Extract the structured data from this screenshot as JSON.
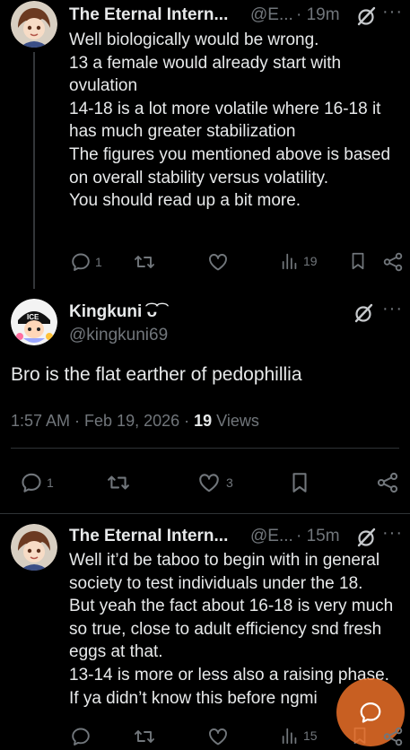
{
  "colors": {
    "bg": "#000000",
    "text": "#e7e9ea",
    "muted": "#71767b",
    "divider": "#2f3336",
    "fab": "#f4742a"
  },
  "post1": {
    "name": "The Eternal Intern...",
    "handle": "@E...",
    "time": "· 19m",
    "text": "Well biologically would be wrong.\n13 a female would already start with ovulation\n14-18 is a lot more volatile where 16-18 it has much greater stabilization\nThe figures you mentioned above is based on overall stability versus volatility.\nYou should read up a bit more.",
    "replies": "1",
    "views": "19"
  },
  "post2": {
    "name": "Kingkuni ͡ᴗ͡",
    "handle": "@kingkuni69",
    "avatar_badge": "ICE",
    "text": "Bro is the flat earther of pedophillia",
    "timestamp": "1:57 AM · Feb 19, 2026 · ",
    "views_count": "19",
    "views_label": " Views",
    "replies": "1",
    "likes": "3"
  },
  "post3": {
    "name": "The Eternal Intern...",
    "handle": "@E...",
    "time": "· 15m",
    "text": "Well it’d be taboo to begin with in general society to test individuals under the 18.\nBut yeah the fact about 16-18 is very much so true, close to adult efficiency snd fresh eggs at that.\n13-14 is more or less also a raising phase.\nIf ya didn’t know this before ngmi",
    "views": "15"
  },
  "icons": {
    "reply": "reply-icon",
    "retweet": "retweet-icon",
    "like": "like-icon",
    "views": "views-icon",
    "bookmark": "bookmark-icon",
    "share": "share-icon",
    "grok": "grok-slash-icon",
    "more": "more-icon",
    "compose": "compose-fab-icon"
  }
}
